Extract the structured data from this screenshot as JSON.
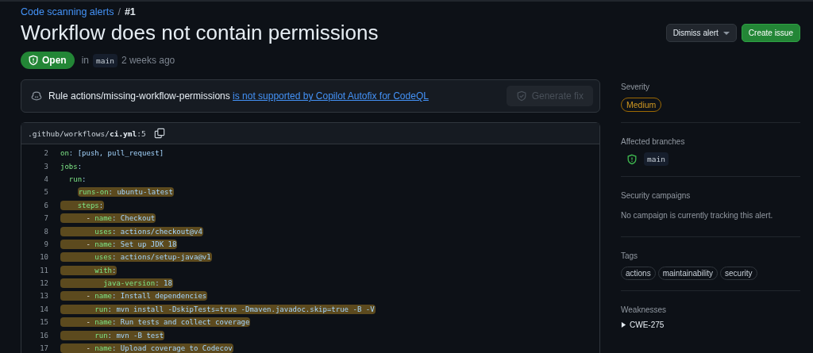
{
  "breadcrumb": {
    "link": "Code scanning alerts",
    "separator": "/",
    "current": "#1"
  },
  "title": "Workflow does not contain permissions",
  "actions": [
    {
      "label": "Dismiss alert",
      "kind": "dropdown"
    },
    {
      "label": "Create issue",
      "kind": "primary"
    }
  ],
  "status": {
    "label": "Open",
    "prefix": "in",
    "branch": "main",
    "time": "2 weeks ago"
  },
  "autofix": {
    "text": "Rule actions/missing-workflow-permissions",
    "link": "is not supported by Copilot Autofix for CodeQL",
    "button": "Generate fix",
    "button_disabled": true
  },
  "file": {
    "path": ".github/workflows/",
    "name": "ci.yml",
    "line": ":5"
  },
  "code": [
    {
      "num": "2",
      "key": "on",
      "rest": ": [push, pull_request]",
      "highlighted": false,
      "kind": "block"
    },
    {
      "num": "3",
      "key": "jobs",
      "rest": ":",
      "highlighted": false,
      "kind": "block",
      "children": [
        {
          "num": "4",
          "key": "run",
          "rest": ":",
          "highlighted": false,
          "kind": "block",
          "children": [
            {
              "num": "5",
              "key": "runs-on",
              "rest": ": ubuntu-latest",
              "highlighted": true,
              "kind": "inline"
            },
            {
              "num": "6",
              "key": "steps",
              "rest": ":",
              "highlighted": true,
              "kind": "block",
              "children": [
                {
                  "num": "7",
                  "dash": "- ",
                  "key": "name",
                  "rest": ": Checkout",
                  "highlighted": true,
                  "kind": "block",
                  "children": [
                    {
                      "num": "8",
                      "key": "uses",
                      "rest": ": actions/checkout@v4",
                      "highlighted": true,
                      "kind": "block"
                    }
                  ]
                },
                {
                  "num": "9",
                  "dash": "- ",
                  "key": "name",
                  "rest": ": Set up JDK 18",
                  "highlighted": true,
                  "kind": "block",
                  "children": [
                    {
                      "num": "10",
                      "key": "uses",
                      "rest": ": actions/setup-java@v1",
                      "highlighted": true,
                      "kind": "block"
                    },
                    {
                      "num": "11",
                      "key": "with",
                      "rest": ":",
                      "highlighted": true,
                      "kind": "block",
                      "children": [
                        {
                          "num": "12",
                          "key": "java-version",
                          "rest": ": 18",
                          "highlighted": true,
                          "kind": "block"
                        }
                      ]
                    }
                  ]
                },
                {
                  "num": "13",
                  "dash": "- ",
                  "key": "name",
                  "rest": ": Install dependencies",
                  "highlighted": true,
                  "kind": "block",
                  "children": [
                    {
                      "num": "14",
                      "key": "run",
                      "rest": ": mvn install -DskipTests=true -Dmaven.javadoc.skip=true -B -V",
                      "highlighted": true,
                      "kind": "block"
                    }
                  ]
                },
                {
                  "num": "15",
                  "dash": "- ",
                  "key": "name",
                  "rest": ": Run tests and collect coverage",
                  "highlighted": true,
                  "kind": "block",
                  "children": [
                    {
                      "num": "16",
                      "key": "run",
                      "rest": ": mvn -B test",
                      "highlighted": true,
                      "kind": "block"
                    }
                  ]
                },
                {
                  "num": "17",
                  "dash": "- ",
                  "key": "name",
                  "rest": ": Upload coverage to Codecov",
                  "highlighted": true,
                  "kind": "block"
                }
              ]
            }
          ]
        }
      ]
    }
  ],
  "sidebar": [
    {
      "heading": "Severity",
      "kind": "severity",
      "label": "Medium"
    },
    {
      "heading": "Affected branches",
      "kind": "branch",
      "label": "main"
    },
    {
      "heading": "Security campaigns",
      "kind": "text",
      "label": "No campaign is currently tracking this alert."
    },
    {
      "heading": "Tags",
      "kind": "tags",
      "tags": [
        "actions",
        "maintainability",
        "security"
      ]
    },
    {
      "heading": "Weaknesses",
      "kind": "disclosure",
      "label": "CWE-275",
      "expanded": false
    }
  ]
}
